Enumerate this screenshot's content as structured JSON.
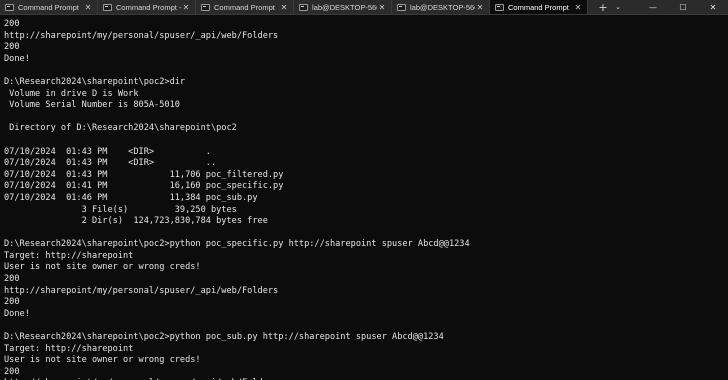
{
  "tabs": [
    {
      "label": "Command Prompt",
      "active": false
    },
    {
      "label": "Command Prompt -",
      "active": false
    },
    {
      "label": "Command Prompt",
      "active": false
    },
    {
      "label": "lab@DESKTOP-56Q",
      "active": false
    },
    {
      "label": "lab@DESKTOP-56Q",
      "active": false
    },
    {
      "label": "Command Prompt",
      "active": true
    }
  ],
  "tab_close_glyph": "✕",
  "new_tab_glyph": "+",
  "dropdown_glyph": "⌄",
  "window_controls": {
    "minimize": "—",
    "maximize": "☐",
    "close": "✕"
  },
  "console_lines": [
    "200",
    "http://sharepoint/my/personal/spuser/_api/web/Folders",
    "200",
    "Done!",
    "",
    "D:\\Research2024\\sharepoint\\poc2>dir",
    " Volume in drive D is Work",
    " Volume Serial Number is 805A-5010",
    "",
    " Directory of D:\\Research2024\\sharepoint\\poc2",
    "",
    "07/10/2024  01:43 PM    <DIR>          .",
    "07/10/2024  01:43 PM    <DIR>          ..",
    "07/10/2024  01:43 PM            11,706 poc_filtered.py",
    "07/10/2024  01:41 PM            16,160 poc_specific.py",
    "07/10/2024  01:46 PM            11,384 poc_sub.py",
    "               3 File(s)         39,250 bytes",
    "               2 Dir(s)  124,723,830,784 bytes free",
    "",
    "D:\\Research2024\\sharepoint\\poc2>python poc_specific.py http://sharepoint spuser Abcd@@1234",
    "Target: http://sharepoint",
    "User is not site owner or wrong creds!",
    "200",
    "http://sharepoint/my/personal/spuser/_api/web/Folders",
    "200",
    "Done!",
    "",
    "D:\\Research2024\\sharepoint\\poc2>python poc_sub.py http://sharepoint spuser Abcd@@1234",
    "Target: http://sharepoint",
    "User is not site owner or wrong creds!",
    "200",
    "http://sharepoint/my/personal/spuser/_api/web/Folders"
  ],
  "colors": {
    "background": "#0c0c0c",
    "tabbar": "#2b2b2b",
    "text": "#e6e6e6"
  },
  "icons": {
    "tab_icon": "terminal-icon"
  }
}
